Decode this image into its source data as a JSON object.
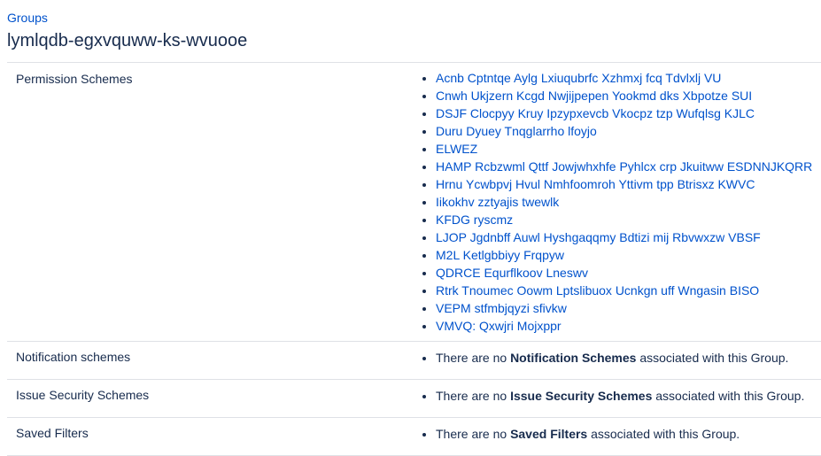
{
  "breadcrumb": {
    "label": "Groups"
  },
  "page": {
    "title": "lymlqdb-egxvquww-ks-wvuooe"
  },
  "rows": {
    "permission": {
      "label": "Permission Schemes",
      "items": [
        "Acnb Cptntqe Aylg Lxiuqubrfc Xzhmxj fcq Tdvlxlj VU",
        "Cnwh Ukjzern Kcgd Nwjijpepen Yookmd dks Xbpotze SUI",
        "DSJF Clocpyy Kruy Ipzypxevcb Vkocpz tzp Wufqlsg KJLC",
        "Duru Dyuey Tnqglarrho lfoyjo",
        "ELWEZ",
        "HAMP Rcbzwml Qttf Jowjwhxhfe Pyhlcx crp Jkuitww ESDNNJKQRR",
        "Hrnu Ycwbpvj Hvul Nmhfoomroh Yttivm tpp Btrisxz KWVC",
        "Iikokhv zztyajis twewlk",
        "KFDG ryscmz",
        "LJOP Jgdnbff Auwl Hyshgaqqmy Bdtizi mij Rbvwxzw VBSF",
        "M2L Ketlgbbiyy Frqpyw",
        "QDRCE Equrflkoov Lneswv",
        "Rtrk Tnoumec Oowm Lptslibuox Ucnkgn uff Wngasin BISO",
        "VEPM stfmbjqyzi sfivkw",
        "VMVQ: Qxwjri Mojxppr"
      ]
    },
    "notification": {
      "label": "Notification schemes",
      "prefix": "There are no ",
      "bold": "Notification Schemes",
      "suffix": " associated with this Group."
    },
    "issue_security": {
      "label": "Issue Security Schemes",
      "prefix": "There are no ",
      "bold": "Issue Security Schemes",
      "suffix": " associated with this Group."
    },
    "saved_filters": {
      "label": "Saved Filters",
      "prefix": "There are no ",
      "bold": "Saved Filters",
      "suffix": " associated with this Group."
    }
  },
  "colors": {
    "link": "#0052cc",
    "text": "#172b4d",
    "border": "#dfe1e6"
  }
}
